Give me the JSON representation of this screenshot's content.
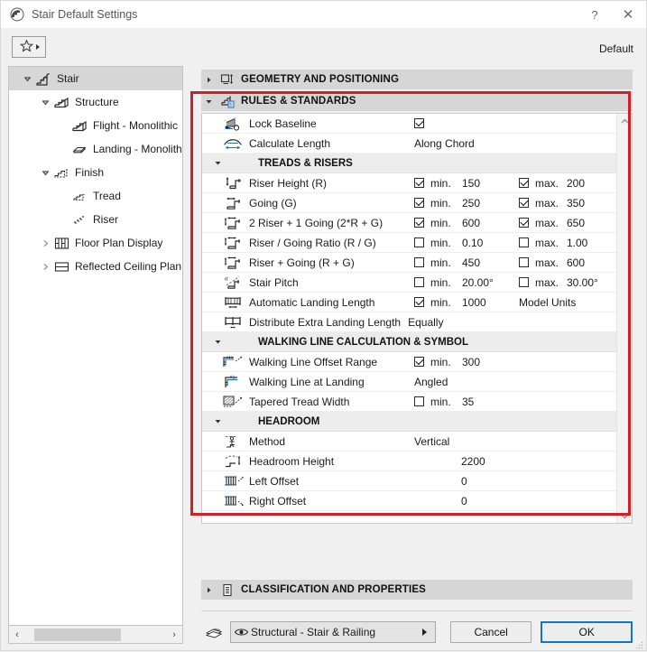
{
  "window": {
    "title": "Stair Default Settings",
    "app_icon": "stair-icon",
    "help_label": "?",
    "close_label": "✕"
  },
  "toolbar": {
    "favorites_icon": "star-icon",
    "default_label": "Default"
  },
  "tree": {
    "items": [
      {
        "label": "Stair",
        "depth": 0,
        "twisty": "down",
        "icon": "stair-icon",
        "selected": true
      },
      {
        "label": "Structure",
        "depth": 1,
        "twisty": "down",
        "icon": "structure-icon",
        "selected": false
      },
      {
        "label": "Flight - Monolithic",
        "depth": 2,
        "twisty": "none",
        "icon": "flight-icon",
        "selected": false
      },
      {
        "label": "Landing - Monolithic",
        "depth": 2,
        "twisty": "none",
        "icon": "landing-icon",
        "selected": false
      },
      {
        "label": "Finish",
        "depth": 1,
        "twisty": "down",
        "icon": "finish-icon",
        "selected": false
      },
      {
        "label": "Tread",
        "depth": 2,
        "twisty": "none",
        "icon": "tread-icon",
        "selected": false
      },
      {
        "label": "Riser",
        "depth": 2,
        "twisty": "none",
        "icon": "riser-icon",
        "selected": false
      },
      {
        "label": "Floor Plan Display",
        "depth": 1,
        "twisty": "right",
        "icon": "floor-plan-icon",
        "selected": false
      },
      {
        "label": "Reflected Ceiling Plan Di",
        "depth": 1,
        "twisty": "right",
        "icon": "ceiling-plan-icon",
        "selected": false
      }
    ],
    "hscroll": {
      "left_arrow": "‹",
      "right_arrow": "›"
    }
  },
  "sections": {
    "geometry": {
      "title": "GEOMETRY AND POSITIONING",
      "expanded": false,
      "icon": "geometry-icon"
    },
    "rules": {
      "title": "RULES & STANDARDS",
      "expanded": true,
      "icon": "rules-icon"
    },
    "classification": {
      "title": "CLASSIFICATION AND PROPERTIES",
      "expanded": false,
      "icon": "document-icon"
    }
  },
  "rows": [
    {
      "kind": "row",
      "icon": "lock-baseline-icon",
      "label": "Lock Baseline",
      "checkbox": true,
      "checkbox_only": true
    },
    {
      "kind": "row",
      "icon": "calculate-length-icon",
      "label": "Calculate Length",
      "value": "Along Chord"
    },
    {
      "kind": "subheader",
      "label": "TREADS & RISERS"
    },
    {
      "kind": "row",
      "icon": "riser-height-icon",
      "label": "Riser Height (R)",
      "min": {
        "checked": true,
        "label": "min.",
        "value": "150"
      },
      "max": {
        "checked": true,
        "label": "max.",
        "value": "200"
      }
    },
    {
      "kind": "row",
      "icon": "going-icon",
      "label": "Going (G)",
      "min": {
        "checked": true,
        "label": "min.",
        "value": "250"
      },
      "max": {
        "checked": true,
        "label": "max.",
        "value": "350"
      }
    },
    {
      "kind": "row",
      "icon": "two-riser-going-icon",
      "label": "2 Riser + 1 Going (2*R + G)",
      "min": {
        "checked": true,
        "label": "min.",
        "value": "600"
      },
      "max": {
        "checked": true,
        "label": "max.",
        "value": "650"
      }
    },
    {
      "kind": "row",
      "icon": "riser-going-ratio-icon",
      "label": "Riser / Going Ratio (R / G)",
      "min": {
        "checked": false,
        "label": "min.",
        "value": "0.10"
      },
      "max": {
        "checked": false,
        "label": "max.",
        "value": "1.00"
      }
    },
    {
      "kind": "row",
      "icon": "riser-plus-going-icon",
      "label": "Riser + Going (R + G)",
      "min": {
        "checked": false,
        "label": "min.",
        "value": "450"
      },
      "max": {
        "checked": false,
        "label": "max.",
        "value": "600"
      }
    },
    {
      "kind": "row",
      "icon": "stair-pitch-icon",
      "label": "Stair Pitch",
      "min": {
        "checked": false,
        "label": "min.",
        "value": "20.00°"
      },
      "max": {
        "checked": false,
        "label": "max.",
        "value": "30.00°"
      }
    },
    {
      "kind": "row",
      "icon": "landing-length-icon",
      "label": "Automatic Landing Length",
      "min": {
        "checked": true,
        "label": "min.",
        "value": "1000"
      },
      "unit": "Model Units"
    },
    {
      "kind": "row",
      "icon": "distribute-landing-icon",
      "label": "Distribute Extra Landing Length",
      "inline_value": "Equally"
    },
    {
      "kind": "subheader",
      "label": "WALKING LINE CALCULATION & SYMBOL"
    },
    {
      "kind": "row",
      "icon": "walking-line-offset-icon",
      "label": "Walking Line Offset Range",
      "min": {
        "checked": true,
        "label": "min.",
        "value": "300"
      }
    },
    {
      "kind": "row",
      "icon": "walking-line-landing-icon",
      "label": "Walking Line at Landing",
      "value": "Angled"
    },
    {
      "kind": "row",
      "icon": "tapered-tread-icon",
      "label": "Tapered Tread Width",
      "min": {
        "checked": false,
        "label": "min.",
        "value": "35"
      }
    },
    {
      "kind": "subheader",
      "label": "HEADROOM"
    },
    {
      "kind": "row",
      "icon": "headroom-method-icon",
      "label": "Method",
      "value": "Vertical"
    },
    {
      "kind": "row",
      "icon": "headroom-height-icon",
      "label": "Headroom Height",
      "value_right": "2200"
    },
    {
      "kind": "row",
      "icon": "left-offset-icon",
      "label": "Left Offset",
      "value_right": "0"
    },
    {
      "kind": "row",
      "icon": "right-offset-icon",
      "label": "Right Offset",
      "value_right": "0"
    }
  ],
  "footer": {
    "layers_icon": "layers-icon",
    "layer_combo": {
      "icon": "eye-icon",
      "value": "Structural - Stair & Railing"
    },
    "cancel_label": "Cancel",
    "ok_label": "OK"
  },
  "colors": {
    "accent_blue": "#1076c9",
    "highlight_red": "#cf2027",
    "section_header_bg": "#d6d6d6",
    "subheader_bg": "#ececec",
    "icon_blue": "#2a6fbb"
  }
}
